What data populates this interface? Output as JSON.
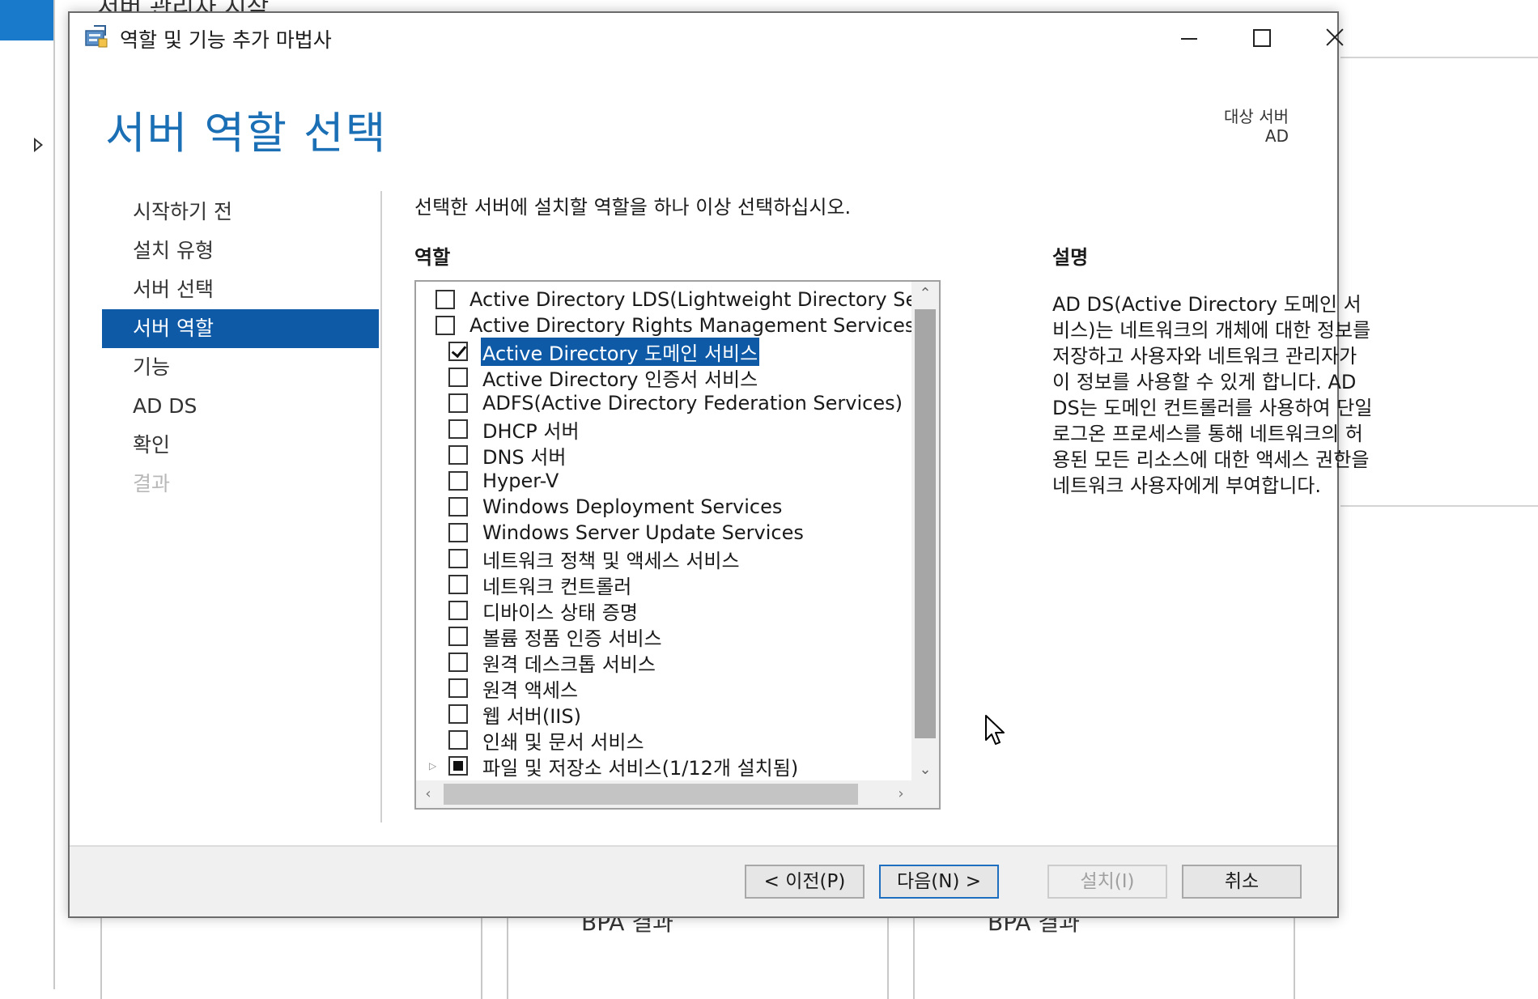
{
  "background": {
    "app_title": "서버 관리자 시작",
    "panels": [
      "BPA 결과",
      "BPA 결과"
    ]
  },
  "window": {
    "title": "역할 및 기능 추가 마법사"
  },
  "header": {
    "page_title": "서버 역할 선택",
    "target_label": "대상 서버",
    "target_value": "AD"
  },
  "nav": {
    "items": [
      {
        "label": "시작하기 전",
        "state": "normal"
      },
      {
        "label": "설치 유형",
        "state": "normal"
      },
      {
        "label": "서버 선택",
        "state": "normal"
      },
      {
        "label": "서버 역할",
        "state": "active"
      },
      {
        "label": "기능",
        "state": "normal"
      },
      {
        "label": "AD DS",
        "state": "normal"
      },
      {
        "label": "확인",
        "state": "normal"
      },
      {
        "label": "결과",
        "state": "disabled"
      }
    ]
  },
  "content": {
    "instruction": "선택한 서버에 설치할 역할을 하나 이상 선택하십시오.",
    "roles_header": "역할",
    "description_header": "설명",
    "description": "AD DS(Active Directory 도메인 서비스)는 네트워크의 개체에 대한 정보를 저장하고 사용자와 네트워크 관리자가 이 정보를 사용할 수 있게 합니다. AD DS는 도메인 컨트롤러를 사용하여 단일 로그온 프로세스를 통해 네트워크의 허용된 모든 리소스에 대한 액세스 권한을 네트워크 사용자에게 부여합니다."
  },
  "roles": [
    {
      "label": "Active Directory LDS(Lightweight Directory Servic",
      "checked": "no"
    },
    {
      "label": "Active Directory Rights Management Services",
      "checked": "no"
    },
    {
      "label": "Active Directory 도메인 서비스",
      "checked": "yes",
      "selected": true
    },
    {
      "label": "Active Directory 인증서 서비스",
      "checked": "no"
    },
    {
      "label": "ADFS(Active Directory Federation Services)",
      "checked": "no"
    },
    {
      "label": "DHCP 서버",
      "checked": "no"
    },
    {
      "label": "DNS 서버",
      "checked": "no"
    },
    {
      "label": "Hyper-V",
      "checked": "no"
    },
    {
      "label": "Windows Deployment Services",
      "checked": "no"
    },
    {
      "label": "Windows Server Update Services",
      "checked": "no"
    },
    {
      "label": "네트워크 정책 및 액세스 서비스",
      "checked": "no"
    },
    {
      "label": "네트워크 컨트롤러",
      "checked": "no"
    },
    {
      "label": "디바이스 상태 증명",
      "checked": "no"
    },
    {
      "label": "볼륨 정품 인증 서비스",
      "checked": "no"
    },
    {
      "label": "원격 데스크톱 서비스",
      "checked": "no"
    },
    {
      "label": "원격 액세스",
      "checked": "no"
    },
    {
      "label": "웹 서버(IIS)",
      "checked": "no"
    },
    {
      "label": "인쇄 및 문서 서비스",
      "checked": "no"
    },
    {
      "label": "파일 및 저장소 서비스(1/12개 설치됨)",
      "checked": "partial",
      "expandable": true
    }
  ],
  "buttons": {
    "prev": "< 이전(P)",
    "next": "다음(N) >",
    "install": "설치(I)",
    "cancel": "취소"
  },
  "icons": {
    "app": "wizard-app-icon",
    "minimize": "minimize-icon",
    "maximize": "maximize-icon",
    "close": "close-icon"
  }
}
